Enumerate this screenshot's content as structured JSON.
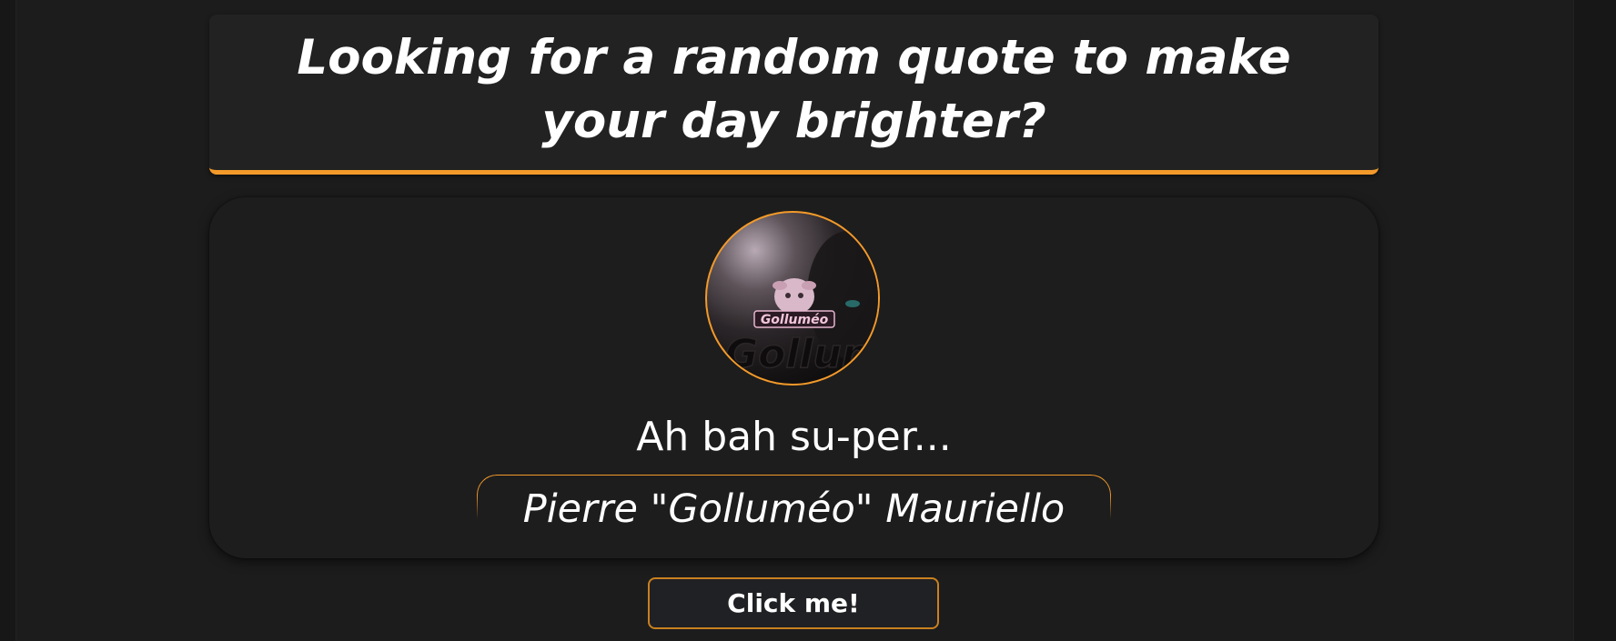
{
  "header": {
    "headline": "Looking for a random quote to make your day brighter?"
  },
  "quote": {
    "text": "Ah bah su-per...",
    "author": "Pierre \"Golluméo\" Mauriello",
    "avatar_logo_text": "Golluméo"
  },
  "button": {
    "label": "Click me!"
  },
  "colors": {
    "background": "#1c1c1c",
    "card": "#222222",
    "accent": "#f39a2a",
    "text": "#ffffff"
  }
}
